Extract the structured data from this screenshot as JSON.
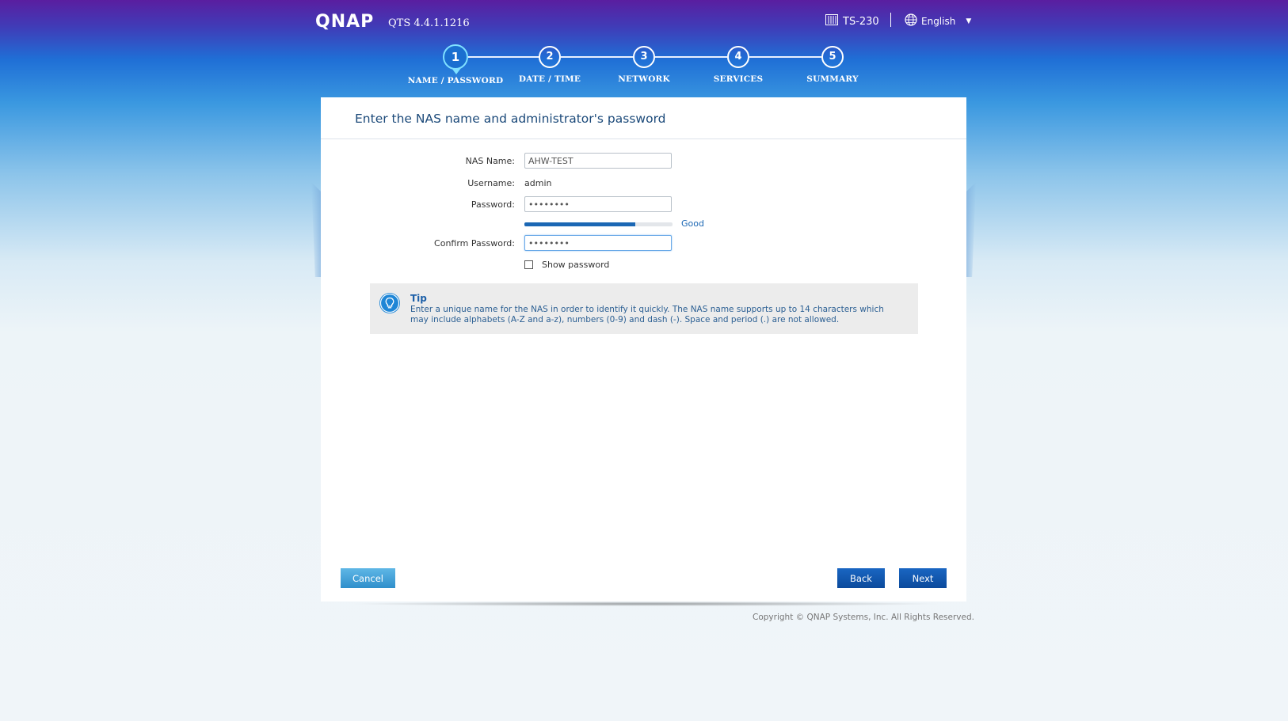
{
  "header": {
    "logo": "QNAP",
    "version": "QTS 4.4.1.1216",
    "device": "TS-230",
    "language": "English"
  },
  "steps": [
    {
      "number": "1",
      "label": "NAME / PASSWORD",
      "active": true
    },
    {
      "number": "2",
      "label": "DATE / TIME"
    },
    {
      "number": "3",
      "label": "NETWORK"
    },
    {
      "number": "4",
      "label": "SERVICES"
    },
    {
      "number": "5",
      "label": "SUMMARY"
    }
  ],
  "panel": {
    "title": "Enter the NAS name and administrator's password"
  },
  "form": {
    "nas_name_label": "NAS Name:",
    "nas_name_value": "AHW-TEST",
    "username_label": "Username:",
    "username_value": "admin",
    "password_label": "Password:",
    "password_value": "••••••••",
    "strength_level": 0.75,
    "strength_text": "Good",
    "confirm_label": "Confirm Password:",
    "confirm_value": "••••••••",
    "show_password_label": "Show password"
  },
  "tip": {
    "title": "Tip",
    "text": "Enter a unique name for the NAS in order to identify it quickly. The NAS name supports up to 14 characters which may include alphabets (A-Z and a-z), numbers (0-9) and dash (-). Space and period (.) are not allowed."
  },
  "buttons": {
    "cancel": "Cancel",
    "back": "Back",
    "next": "Next"
  },
  "footer": {
    "copyright": "Copyright © QNAP Systems, Inc. All Rights Reserved."
  },
  "colors": {
    "accent": "#1b67b4",
    "title": "#1c4a7a"
  }
}
